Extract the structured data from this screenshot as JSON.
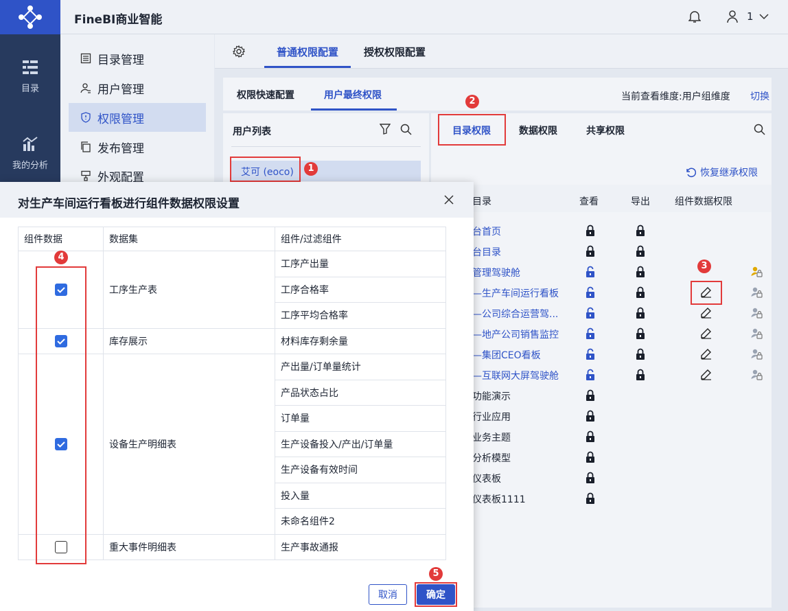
{
  "app": {
    "title": "FineBI商业智能",
    "user": "1"
  },
  "side": [
    {
      "label": "目录"
    },
    {
      "label": "我的分析"
    }
  ],
  "nav": [
    {
      "label": "目录管理",
      "icon": "list-icon"
    },
    {
      "label": "用户管理",
      "icon": "user-icon"
    },
    {
      "label": "权限管理",
      "icon": "shield-icon"
    },
    {
      "label": "发布管理",
      "icon": "copy-icon"
    },
    {
      "label": "外观配置",
      "icon": "brush-icon"
    }
  ],
  "top_tabs": {
    "normal": "普通权限配置",
    "grant": "授权权限配置"
  },
  "sub_tabs": {
    "quick": "权限快速配置",
    "final": "用户最终权限"
  },
  "dimension": {
    "text": "当前查看维度:用户组维度",
    "switch": "切换"
  },
  "user_list": {
    "title": "用户列表",
    "selected": "艾可 (eoco)"
  },
  "perm_tabs": {
    "dir": "目录权限",
    "data": "数据权限",
    "share": "共享权限"
  },
  "restore": "恢复继承权限",
  "columns": {
    "dir": "目录",
    "view": "查看",
    "export": "导出",
    "comp": "组件数据权限"
  },
  "rows": [
    {
      "name": "台首页"
    },
    {
      "name": "台目录"
    },
    {
      "name": "管理驾驶舱"
    },
    {
      "name": "—生产车间运行看板"
    },
    {
      "name": "—公司综合运营驾..."
    },
    {
      "name": "—地产公司销售监控"
    },
    {
      "name": "—集团CEO看板"
    },
    {
      "name": "—互联网大屏驾驶舱"
    },
    {
      "name": "功能演示"
    },
    {
      "name": "行业应用"
    },
    {
      "name": "业务主题"
    },
    {
      "name": "分析模型"
    },
    {
      "name": "仪表板"
    },
    {
      "name": "仪表板1111"
    }
  ],
  "modal": {
    "title": "对生产车间运行看板进行组件数据权限设置",
    "headers": {
      "comp_data": "组件数据",
      "dataset": "数据集",
      "comp": "组件/过滤组件"
    },
    "groups": [
      {
        "dataset": "工序生产表",
        "checked": true,
        "comps": [
          "工序产出量",
          "工序合格率",
          "工序平均合格率"
        ]
      },
      {
        "dataset": "库存展示",
        "checked": true,
        "comps": [
          "材料库存剩余量"
        ]
      },
      {
        "dataset": "设备生产明细表",
        "checked": true,
        "comps": [
          "产出量/订单量统计",
          "产品状态占比",
          "订单量",
          "生产设备投入/产出/订单量",
          "生产设备有效时间",
          "投入量",
          "未命名组件2"
        ]
      },
      {
        "dataset": "重大事件明细表",
        "checked": false,
        "comps": [
          "生产事故通报"
        ]
      }
    ],
    "cancel": "取消",
    "ok": "确定"
  },
  "badges": [
    "1",
    "2",
    "3",
    "4",
    "5"
  ],
  "colors": {
    "accent": "#2f53c7",
    "sidebar": "#273a5e",
    "marker": "#e23a3a"
  }
}
